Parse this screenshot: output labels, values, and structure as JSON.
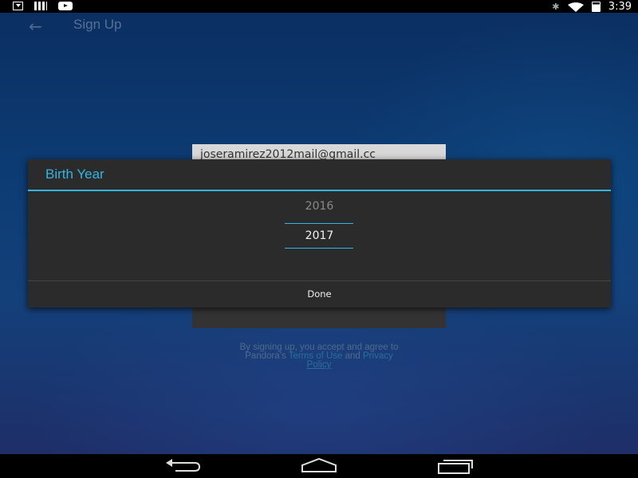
{
  "status_bar": {
    "time": "3:39",
    "icons": [
      "download-icon",
      "signal-bars-icon",
      "youtube-icon",
      "bluetooth-icon",
      "wifi-icon",
      "battery-charging-icon"
    ]
  },
  "app": {
    "title": "Sign Up",
    "email_value": "joseramirez2012mail@gmail.cc",
    "terms": {
      "prefix": "By signing up, you accept and agree to",
      "line2_prefix": "Pandora's ",
      "terms_link": "Terms of Use",
      "and": " and ",
      "privacy_link_1": "Privacy",
      "privacy_link_2": "Policy"
    }
  },
  "dialog": {
    "title": "Birth Year",
    "previous_year": "2016",
    "selected_year": "2017",
    "done_label": "Done"
  },
  "nav_bar": {
    "buttons": [
      "back-icon",
      "home-icon",
      "recents-icon"
    ]
  },
  "colors": {
    "accent": "#33b5e5",
    "dialog_bg": "#2b2b2b",
    "app_bg": "#0c3b73"
  }
}
